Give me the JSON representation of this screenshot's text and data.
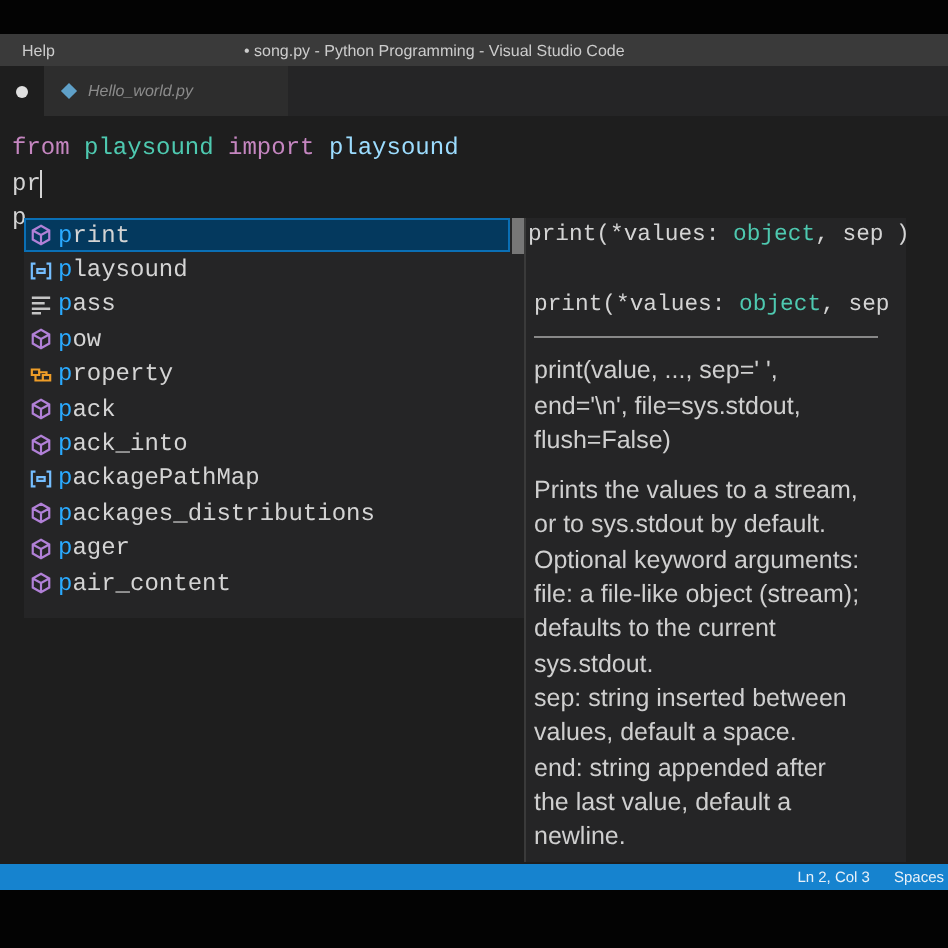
{
  "window": {
    "title": "• song.py - Python Programming - Visual Studio Code"
  },
  "menu": [
    "Help"
  ],
  "tabs": [
    {
      "modified": true,
      "selected": true
    },
    {
      "label": "Hello_world.py",
      "modified": false,
      "selected": false
    }
  ],
  "editor": {
    "lines": [
      {
        "tokens": [
          {
            "text": "from ",
            "kind": "keyword"
          },
          {
            "text": "playsound ",
            "kind": "module"
          },
          {
            "text": "import ",
            "kind": "keyword"
          },
          {
            "text": "playsound",
            "kind": "name"
          }
        ],
        "cursor": false
      },
      {
        "tokens": [
          {
            "text": "pr",
            "kind": "plain"
          }
        ],
        "cursor": true
      },
      {
        "tokens": [
          {
            "text": "p",
            "kind": "plain"
          }
        ],
        "cursor": false
      }
    ]
  },
  "suggestions": [
    {
      "match": "p",
      "rest": "rint",
      "kind": "function",
      "selected": true
    },
    {
      "match": "p",
      "rest": "laysound",
      "kind": "variable",
      "selected": false
    },
    {
      "match": "p",
      "rest": "ass",
      "kind": "keyword",
      "selected": false
    },
    {
      "match": "p",
      "rest": "ow",
      "kind": "function",
      "selected": false
    },
    {
      "match": "p",
      "rest": "roperty",
      "kind": "class",
      "selected": false
    },
    {
      "match": "p",
      "rest": "ack",
      "kind": "function",
      "selected": false
    },
    {
      "match": "p",
      "rest": "ack_into",
      "kind": "function",
      "selected": false
    },
    {
      "match": "p",
      "rest": "ackagePathMap",
      "kind": "variable",
      "selected": false
    },
    {
      "match": "p",
      "rest": "ackages_distributions",
      "kind": "function",
      "selected": false
    },
    {
      "match": "p",
      "rest": "ager",
      "kind": "function",
      "selected": false
    },
    {
      "match": "p",
      "rest": "air_content",
      "kind": "function",
      "selected": false
    }
  ],
  "signature_hint": {
    "name": "print(*values: ",
    "type": "object",
    "rest": ", sep",
    "tail": ")"
  },
  "details": {
    "signature": {
      "name": "print(*values: ",
      "type": "object",
      "rest": ", sep"
    },
    "doc_signature": [
      "print(value, ..., sep=' ',",
      "end='\\n', file=sys.stdout,",
      "flush=False)"
    ],
    "doc": [
      "Prints the values to a stream,",
      "or to sys.stdout by default.",
      "Optional keyword arguments:",
      "file: a file-like object (stream);",
      "defaults to the current",
      "sys.stdout.",
      "sep: string inserted between",
      "values, default a space.",
      "end: string appended after",
      "the last value, default a",
      "newline."
    ]
  },
  "status_bar": {
    "items": [
      "Ln 2, Col 3",
      "Spaces"
    ]
  }
}
